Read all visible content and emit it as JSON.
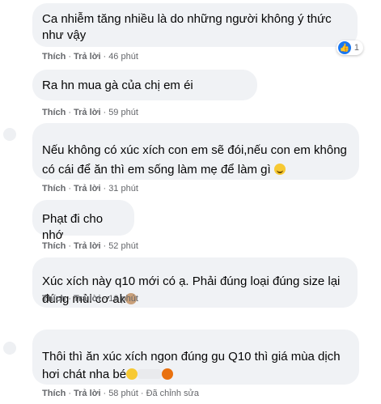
{
  "comments": [
    {
      "text_lines": [
        "Ca nhiễm tăng nhiều là do những người không ý thức",
        "như vậy"
      ],
      "like": "Thích",
      "reply": "Trả lời",
      "time": "46 phút",
      "reaction_count": "1"
    },
    {
      "text_lines": [
        "Ra hn mua gà của chị em éi"
      ],
      "like": "Thích",
      "reply": "Trả lời",
      "time": "59 phút"
    },
    {
      "text_lines": [
        "Nếu không có xúc xích con em sẽ đói,nếu con em không",
        "có cái để ăn thì em sống làm mẹ để làm gì"
      ],
      "like": "Thích",
      "reply": "Trả lời",
      "time": "31 phút"
    },
    {
      "text_lines": [
        "Phạt đi cho nhớ"
      ],
      "like": "Thích",
      "reply": "Trả lời",
      "time": "52 phút"
    },
    {
      "text_lines": [
        "Xúc xích này q10 mới có ạ. Phải đúng loại đúng size lại",
        "đúng mùi cơ ak"
      ],
      "like": "Thích",
      "reply": "Trả lời",
      "time": "16 phút"
    },
    {
      "text_lines": [
        "Thôi thì ăn xúc xích ngon đúng gu Q10 thì giá mùa dịch",
        "hơi chát nha bé"
      ],
      "like": "Thích",
      "reply": "Trả lời",
      "time": "58 phút",
      "edited": "Đã chỉnh sửa"
    }
  ],
  "icons": {
    "reaction": "like-icon",
    "emoji_3": "grinning-emoji-icon",
    "emoji_5": "see-no-evil-monkey-icon",
    "emoji_6a": "laughing-emoji-icon",
    "emoji_6b": "angry-emoji-icon"
  },
  "colors": {
    "bubble": "#f0f2f5",
    "text": "#050505",
    "meta": "#65676b",
    "like_blue": "#1877f2"
  }
}
